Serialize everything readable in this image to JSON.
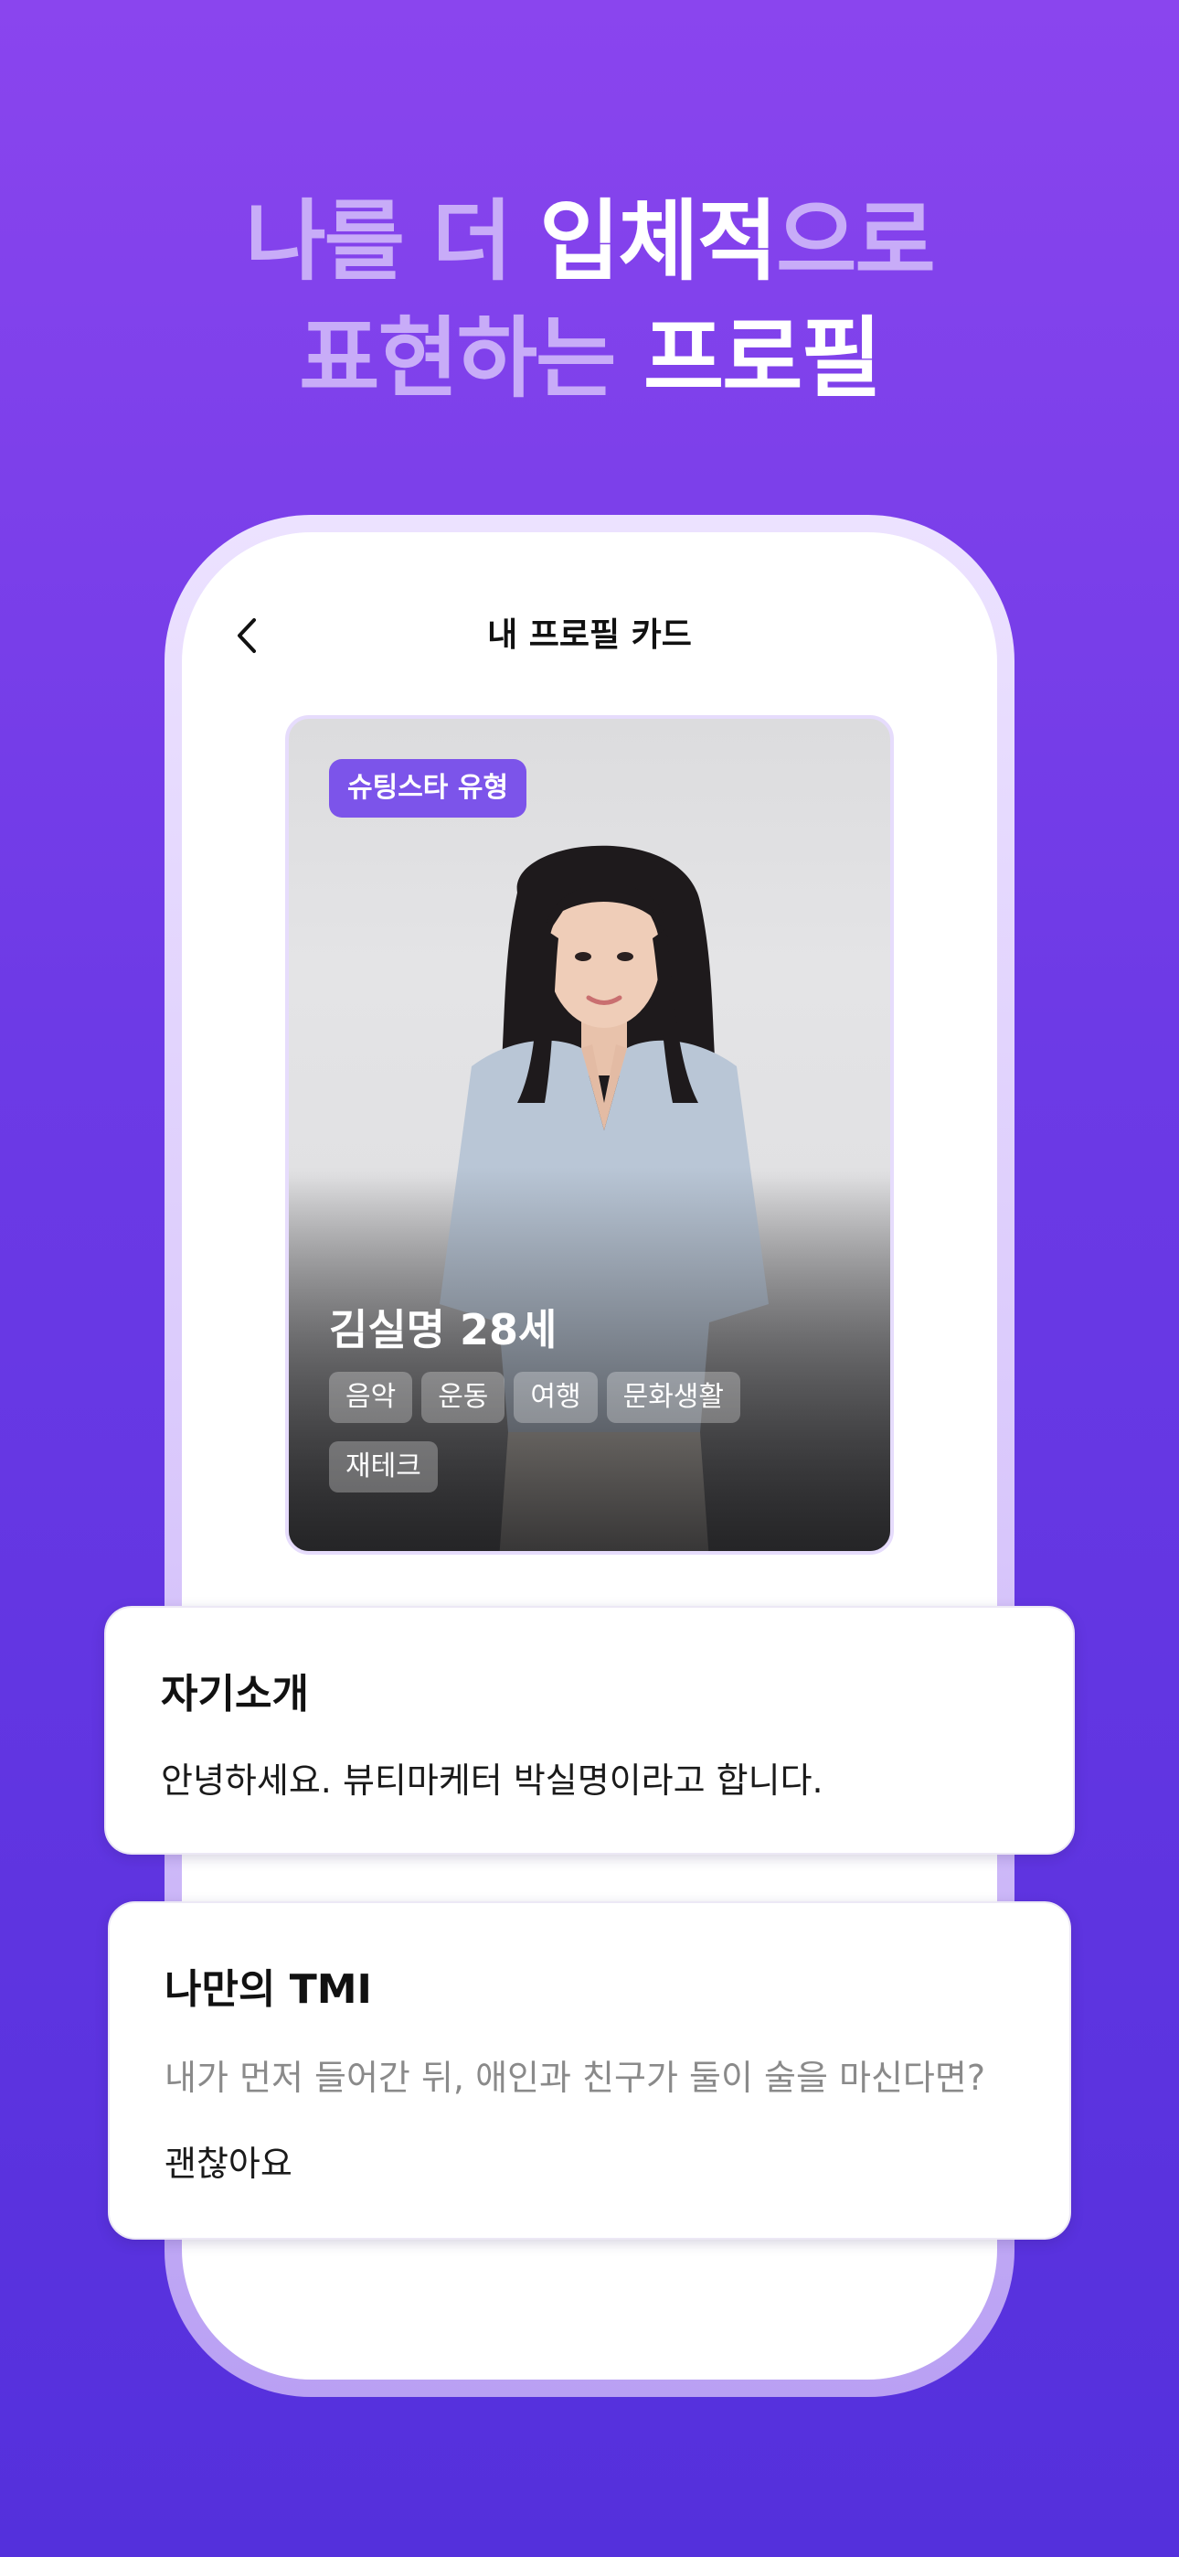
{
  "headline": {
    "line1_soft_a": "나를 더 ",
    "line1_strong": "입체적",
    "line1_soft_b": "으로",
    "line2_soft": "표현하는 ",
    "line2_strong": "프로필"
  },
  "screen": {
    "title": "내 프로필 카드",
    "back_icon": "chevron-left-icon"
  },
  "profile_card": {
    "type_badge": "슈팅스타 유형",
    "name_age": "김실명 28세",
    "tags": [
      "음악",
      "운동",
      "여행",
      "문화생활",
      "재테크"
    ]
  },
  "intro": {
    "heading": "자기소개",
    "body": "안녕하세요. 뷰티마케터 박실명이라고 합니다."
  },
  "tmi": {
    "heading": "나만의 TMI",
    "question": "내가 먼저 들어간 뒤, 애인과 친구가 둘이 술을 마신다면?",
    "answer": "괜찮아요"
  },
  "colors": {
    "background_top": "#8a45ee",
    "background_bottom": "#5430dc",
    "headline_soft": "#c8acf8",
    "badge": "#7c54ea"
  }
}
